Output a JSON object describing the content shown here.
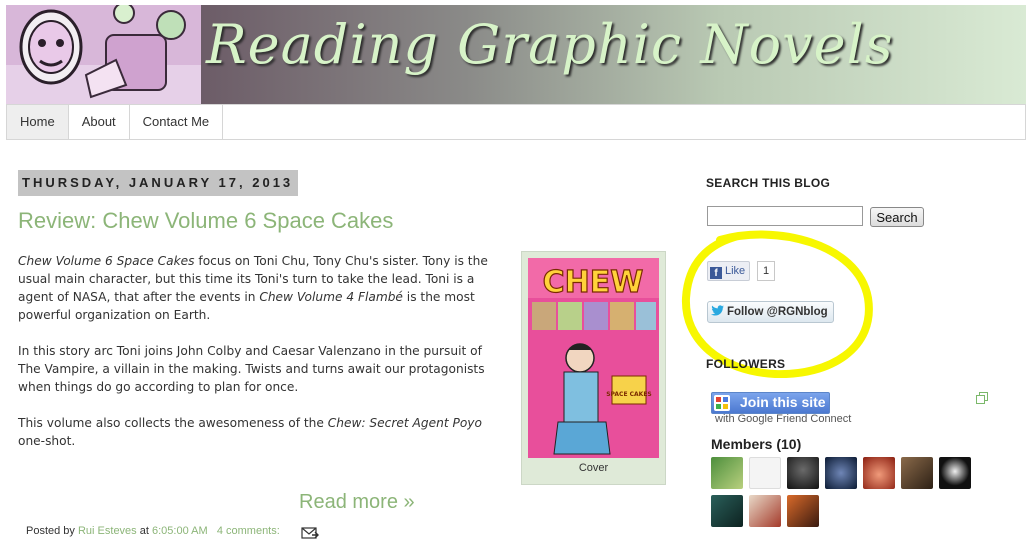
{
  "header": {
    "blog_title": "Reading Graphic Novels"
  },
  "nav": {
    "tabs": [
      "Home",
      "About",
      "Contact Me"
    ]
  },
  "post": {
    "date": "THURSDAY, JANUARY 17, 2013",
    "title": "Review: Chew Volume 6 Space Cakes",
    "body": {
      "p1_italic1": "Chew Volume 6 Space Cakes",
      "p1_text1": " focus on Toni Chu, Tony Chu's sister. Tony is the usual main character, but this time its Toni's turn to take the lead. Toni is a agent of NASA, that after the events in ",
      "p1_italic2": "Chew Volume 4 Flambé",
      "p1_text2": " is the most powerful organization on Earth.",
      "p2": "In this story arc Toni joins John Colby and Caesar Valenzano in the pursuit of The Vampire, a villain in the making. Twists and turns await our protagonists when things do go according to plan for once.",
      "p3_text1": "This volume also collects the awesomeness of the ",
      "p3_italic": "Chew: Secret Agent Poyo",
      "p3_text2": " one-shot."
    },
    "figure": {
      "cover_title": "CHEW",
      "cover_subtitle": "SPACE CAKES",
      "caption": "Cover"
    },
    "read_more": "Read more »",
    "footer": {
      "posted_by": "Posted by",
      "author": "Rui Esteves",
      "at": "at",
      "time": "6:05:00 AM",
      "comments": "4 comments:"
    }
  },
  "sidebar": {
    "search_title": "SEARCH THIS BLOG",
    "search_value": "",
    "search_button": "Search",
    "like_label": "Like",
    "like_count": "1",
    "follow_label": "Follow @RGNblog",
    "followers_title": "FOLLOWERS",
    "join_label": "Join this site",
    "gfc_text": "with Google Friend Connect",
    "members_title": "Members (10)",
    "highlight_color": "#f7f700"
  },
  "colors": {
    "link_green": "#8cb578",
    "date_bg": "#c3c3c3",
    "figure_bg": "#dfead8"
  }
}
